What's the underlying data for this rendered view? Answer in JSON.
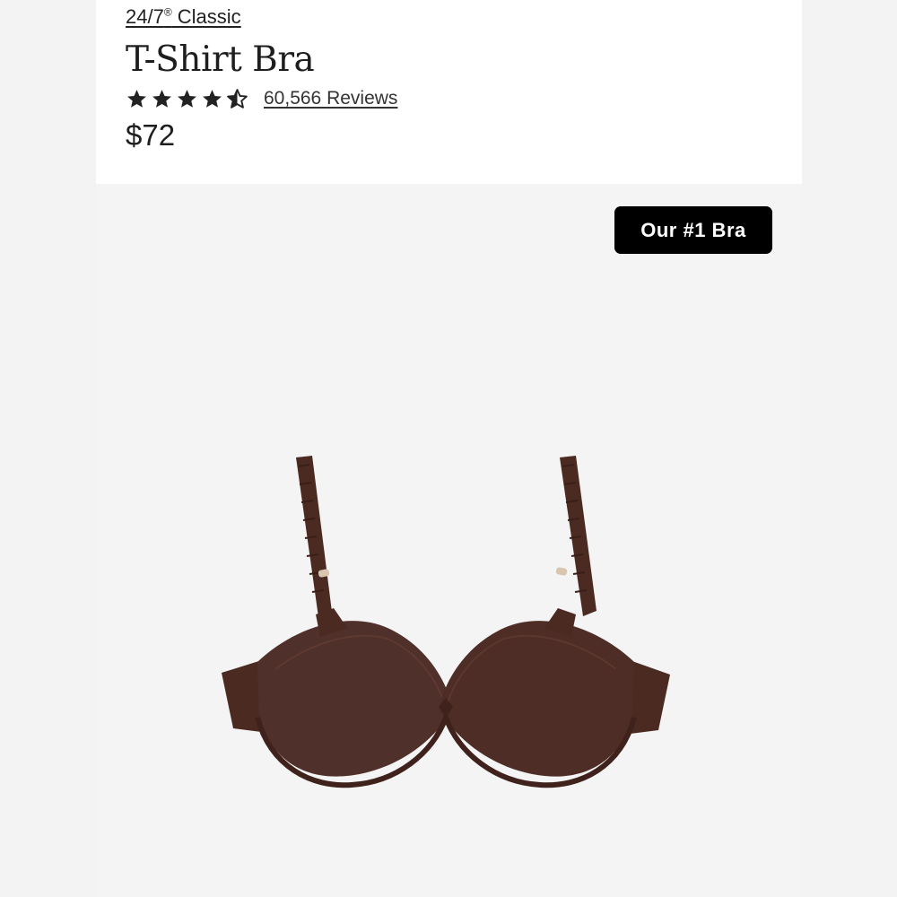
{
  "product": {
    "collection_name": "24/7",
    "collection_reg": "®",
    "collection_suffix": " Classic",
    "title": "T-Shirt Bra",
    "rating": 4.5,
    "rating_max": 5,
    "reviews_label": "60,566 Reviews",
    "price": "$72",
    "badge": "Our #1 Bra",
    "image_icon": "bra-product-image"
  },
  "colors": {
    "text": "#1e1e1e",
    "badge_bg": "#000000",
    "badge_text": "#ffffff",
    "product_color": "#4a2a21"
  }
}
